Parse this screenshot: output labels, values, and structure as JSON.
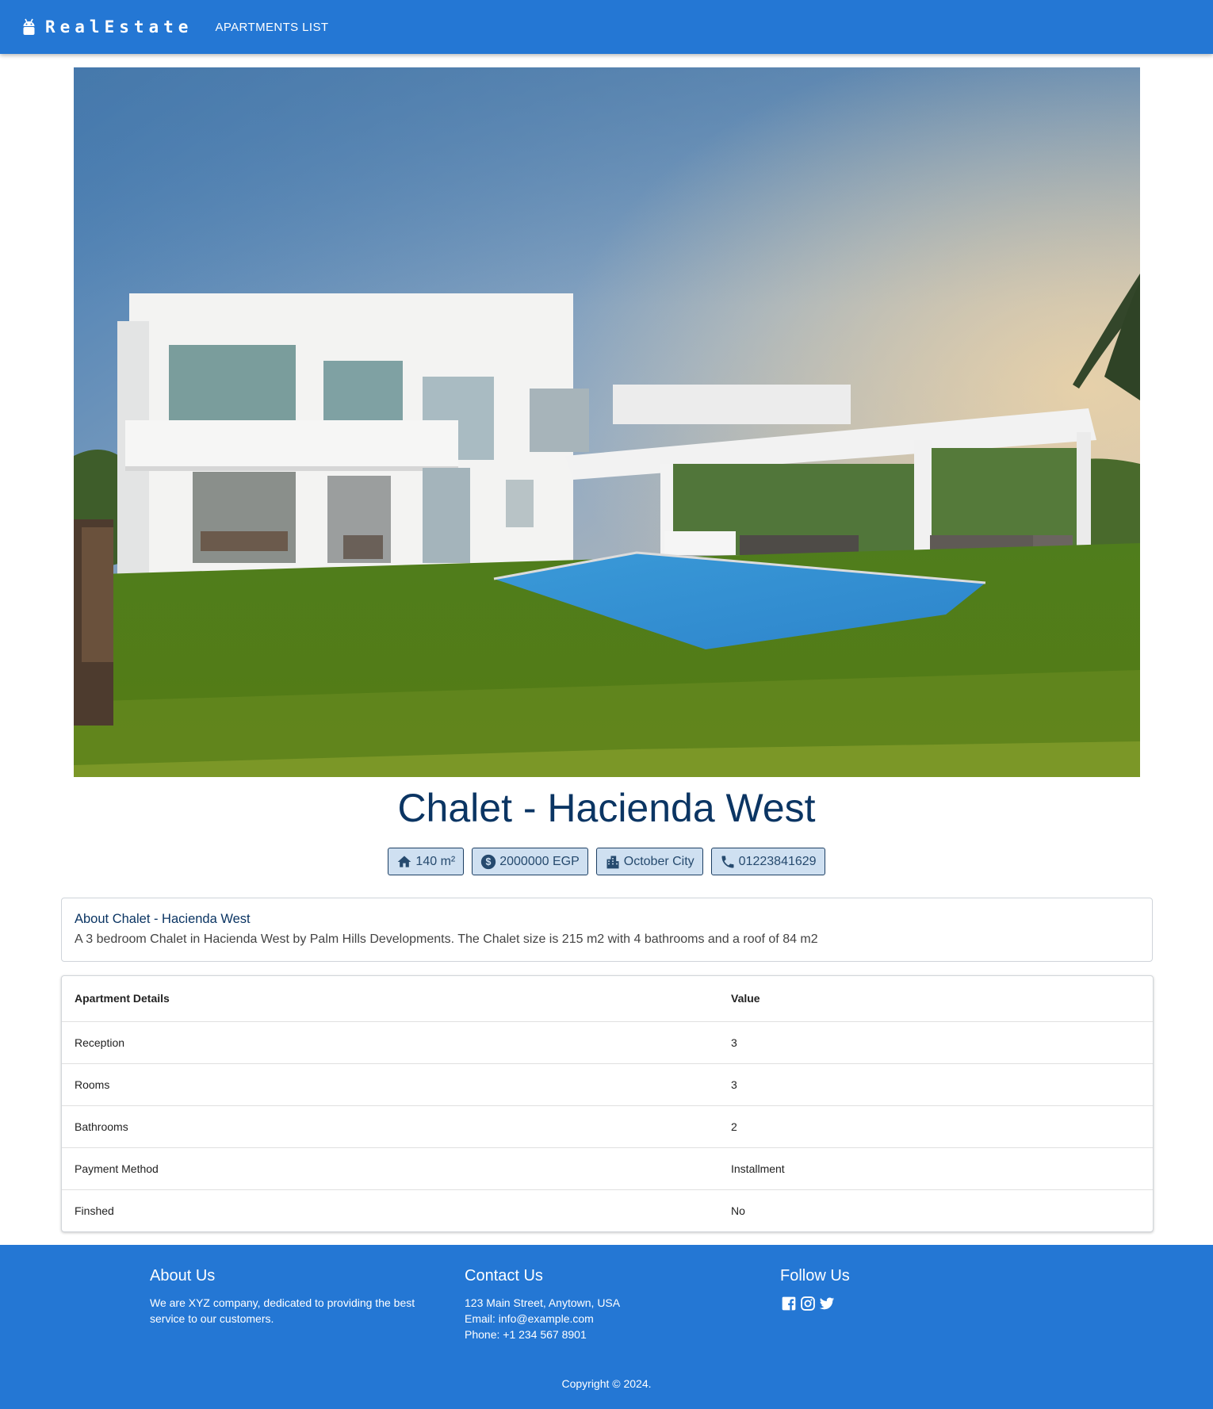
{
  "appbar": {
    "brand": "RealEstate",
    "brand_icon": "android-icon",
    "nav_link": "APARTMENTS LIST",
    "color": "#2477d4"
  },
  "hero": {
    "icon": "villa-photo"
  },
  "listing": {
    "title": "Chalet - Hacienda West",
    "chips": {
      "area": "140 m²",
      "price": "2000000 EGP",
      "city": "October City",
      "phone": "01223841629"
    },
    "title_color": "#0b3563"
  },
  "about": {
    "title": "About Chalet - Hacienda West",
    "text": "A 3 bedroom Chalet in Hacienda West by Palm Hills Developments. The Chalet size is 215 m2 with 4 bathrooms and a roof of 84 m2"
  },
  "details": {
    "headers": [
      "Apartment Details",
      "Value"
    ],
    "rows": [
      {
        "label": "Reception",
        "value": "3"
      },
      {
        "label": "Rooms",
        "value": "3"
      },
      {
        "label": "Bathrooms",
        "value": "2"
      },
      {
        "label": "Payment Method",
        "value": "Installment"
      },
      {
        "label": "Finshed",
        "value": "No"
      }
    ]
  },
  "footer": {
    "about_title": "About Us",
    "about_text": "We are XYZ company, dedicated to providing the best service to our customers.",
    "contact_title": "Contact Us",
    "contact_address": "123 Main Street, Anytown, USA",
    "contact_email": "Email: info@example.com",
    "contact_phone": "Phone: +1 234 567 8901",
    "follow_title": "Follow Us",
    "social_icons": [
      "facebook-icon",
      "instagram-icon",
      "twitter-icon"
    ],
    "copyright": "Copyright © 2024."
  }
}
